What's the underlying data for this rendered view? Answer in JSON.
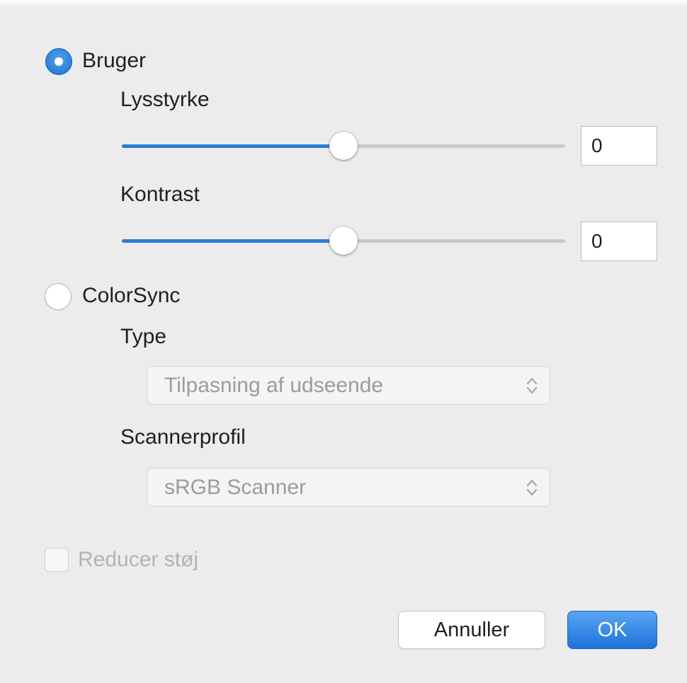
{
  "color_mode": {
    "options": [
      {
        "label": "Bruger",
        "selected": true
      },
      {
        "label": "ColorSync",
        "selected": false
      }
    ]
  },
  "brightness": {
    "label": "Lysstyrke",
    "value": "0",
    "slider_fraction": 0.5
  },
  "contrast": {
    "label": "Kontrast",
    "value": "0",
    "slider_fraction": 0.5
  },
  "colorsync": {
    "type_label": "Type",
    "type_value": "Tilpasning af udseende",
    "profile_label": "Scannerprofil",
    "profile_value": "sRGB Scanner"
  },
  "noise": {
    "label": "Reducer støj",
    "checked": false
  },
  "buttons": {
    "cancel": "Annuller",
    "ok": "OK"
  },
  "colors": {
    "accent": "#2b7bd6",
    "background": "#ececec"
  },
  "icons": {
    "popup_chevron": "up-down-chevron-icon"
  }
}
